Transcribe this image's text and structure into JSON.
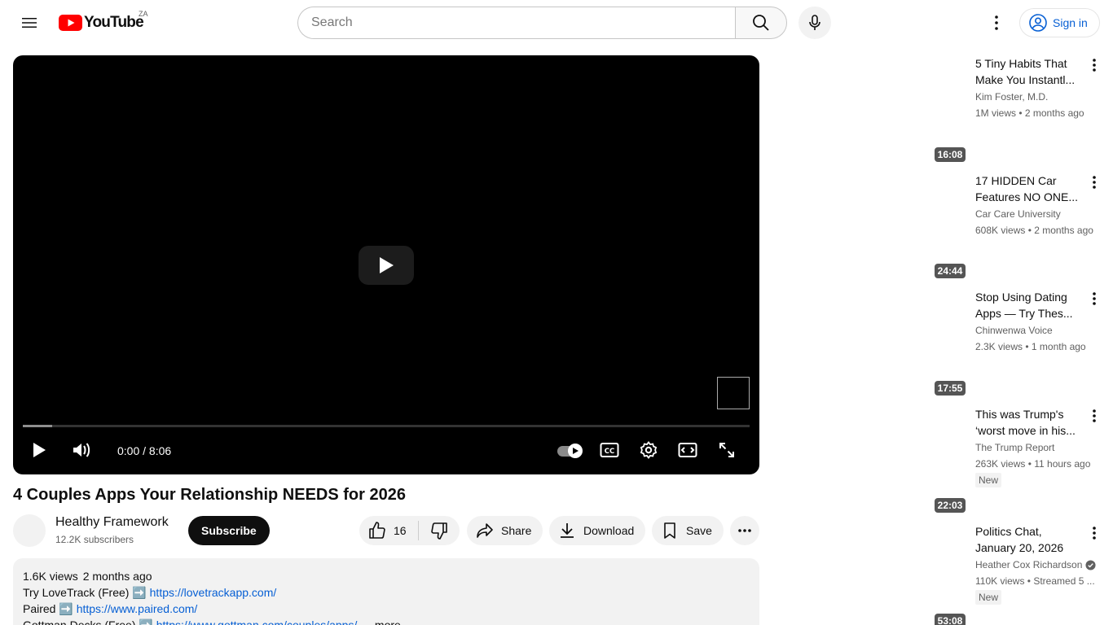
{
  "header": {
    "logo_text": "YouTube",
    "country_code": "ZA",
    "search_placeholder": "Search",
    "sign_in_label": "Sign in",
    "brand_color": "#ff0000",
    "link_color": "#065fd4"
  },
  "player": {
    "time_display": "0:00 / 8:06",
    "progress_fraction": 0.04
  },
  "video": {
    "title": "4 Couples Apps Your Relationship NEEDS for 2026",
    "channel_name": "Healthy Framework",
    "subscribers": "12.2K subscribers",
    "subscribe_label": "Subscribe",
    "like_count": "16",
    "share_label": "Share",
    "download_label": "Download",
    "save_label": "Save"
  },
  "description": {
    "views": "1.6K views",
    "date": "2 months ago",
    "line1_text": "Try LoveTrack (Free) ➡️",
    "line1_link": "https://lovetrackapp.com/",
    "line2_text": "Paired ➡️",
    "line2_link": "https://www.paired.com/",
    "line3_text": "Gottman Decks (Free) ➡️",
    "line3_link": "https://www.gottman.com/couples/apps/",
    "more_label": "...more"
  },
  "recommendations": [
    {
      "title_line1": "5 Tiny Habits That",
      "title_line2": "Make You Instantl...",
      "channel": "Kim Foster, M.D.",
      "meta": "1M views • 2 months ago"
    },
    {
      "duration": "16:08",
      "title_line1": "17 HIDDEN Car",
      "title_line2": "Features NO ONE...",
      "channel": "Car Care University",
      "meta": "608K views • 2 months ago"
    },
    {
      "duration": "24:44",
      "title_line1": "Stop Using Dating",
      "title_line2": "Apps — Try Thes...",
      "channel": "Chinwenwa Voice",
      "meta": "2.3K views • 1 month ago"
    },
    {
      "duration": "17:55",
      "title_line1": "This was Trump's",
      "title_line2": "‘worst move in his...",
      "channel": "The Trump Report",
      "meta": "263K views • 11 hours ago",
      "badge": "New"
    },
    {
      "duration": "22:03",
      "title_line1": "Politics Chat,",
      "title_line2": "January 20, 2026",
      "channel": "Heather Cox Richardson",
      "meta": "110K views • Streamed 5 ...",
      "badge": "New"
    },
    {
      "duration": "53:08"
    }
  ]
}
